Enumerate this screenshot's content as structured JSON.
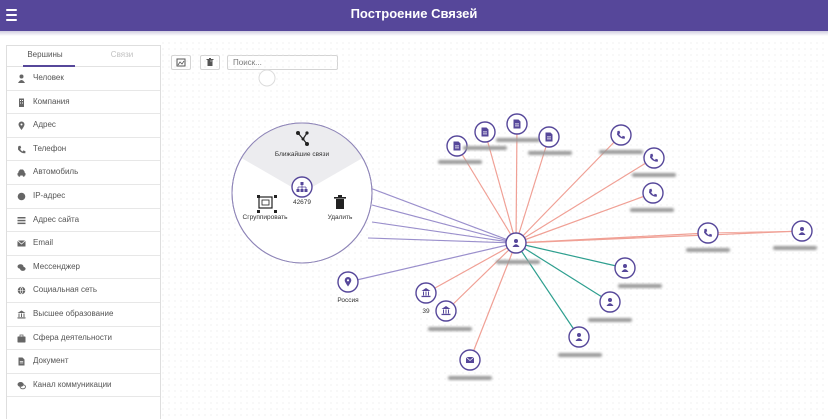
{
  "app": {
    "title": "Построение Связей"
  },
  "sidebar": {
    "tabs": [
      {
        "label": "Вершины"
      },
      {
        "label": "Связи"
      }
    ],
    "items": [
      {
        "label": "Человек",
        "icon": "person-icon"
      },
      {
        "label": "Компания",
        "icon": "building-icon"
      },
      {
        "label": "Адрес",
        "icon": "map-pin-icon"
      },
      {
        "label": "Телефон",
        "icon": "phone-icon"
      },
      {
        "label": "Автомобиль",
        "icon": "car-icon"
      },
      {
        "label": "IP-адрес",
        "icon": "ip-icon"
      },
      {
        "label": "Адрес сайта",
        "icon": "list-icon"
      },
      {
        "label": "Email",
        "icon": "envelope-icon"
      },
      {
        "label": "Мессенджер",
        "icon": "chat-icon"
      },
      {
        "label": "Социальная сеть",
        "icon": "globe-icon"
      },
      {
        "label": "Высшее образование",
        "icon": "university-icon"
      },
      {
        "label": "Сфера деятельности",
        "icon": "briefcase-icon"
      },
      {
        "label": "Документ",
        "icon": "document-icon"
      },
      {
        "label": "Канал коммуникации",
        "icon": "comments-icon"
      }
    ]
  },
  "toolbar": {
    "search_placeholder": "Поиск..."
  },
  "context_menu": {
    "nearest": "Ближайшие связи",
    "group": "Сгруппировать",
    "delete": "Удалить",
    "center_label": "42679"
  },
  "graph": {
    "russia_label": "Россия",
    "univ_label": "39",
    "colors": {
      "purple": "#9a8fcc",
      "red": "#f0a095",
      "teal": "#2e9f8f",
      "node": "#56479a"
    }
  }
}
